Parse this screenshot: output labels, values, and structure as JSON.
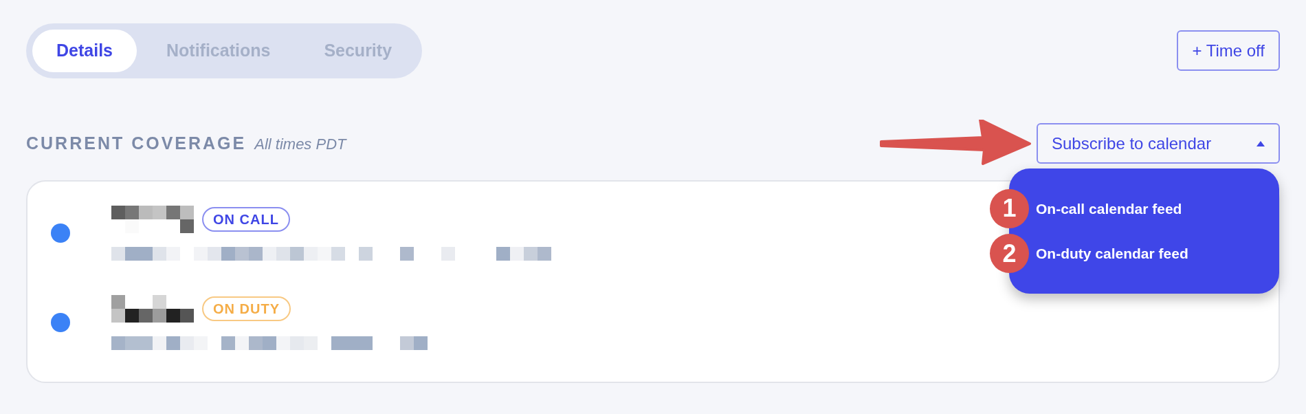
{
  "tabs": [
    {
      "label": "Details",
      "selected": true
    },
    {
      "label": "Notifications",
      "selected": false
    },
    {
      "label": "Security",
      "selected": false
    }
  ],
  "time_off_button": "+ Time off",
  "section": {
    "title": "CURRENT COVERAGE",
    "note": "All times PDT"
  },
  "subscribe": {
    "label": "Subscribe to calendar",
    "expanded": true,
    "menu": [
      {
        "label": "On-call calendar feed",
        "marker": "1"
      },
      {
        "label": "On-duty calendar feed",
        "marker": "2"
      }
    ]
  },
  "rows": [
    {
      "color": "#3b82f6",
      "badge": {
        "label": "ON CALL",
        "kind": "on_call"
      }
    },
    {
      "color": "#3b82f6",
      "badge": {
        "label": "ON DUTY",
        "kind": "on_duty"
      }
    }
  ]
}
